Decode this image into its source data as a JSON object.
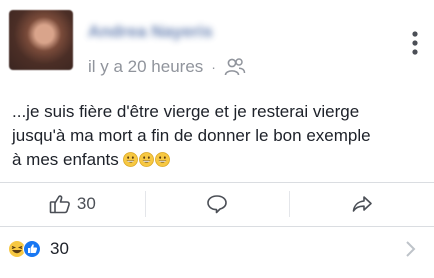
{
  "post": {
    "author_name": "Andrea Nayeris",
    "timestamp": "il y a 20 heures",
    "separator": "·",
    "audience_icon": "friends-icon",
    "text_lines": [
      "...je suis fière d'être vierge et je resterai vierge",
      "jusqu'à ma mort a fin de donner le bon exemple",
      "à mes enfants"
    ],
    "inline_emoji": "grinning-face-icon"
  },
  "actions": {
    "like_count": "30",
    "like_icon": "thumbs-up-icon",
    "comment_icon": "comment-icon",
    "share_icon": "share-icon"
  },
  "reactions": {
    "count": "30",
    "icons": [
      "haha-icon",
      "like-icon"
    ]
  },
  "colors": {
    "accent": "#365899",
    "meta_text": "#90949c",
    "like_blue": "#1877f2",
    "haha_yellow": "#f7c842"
  }
}
